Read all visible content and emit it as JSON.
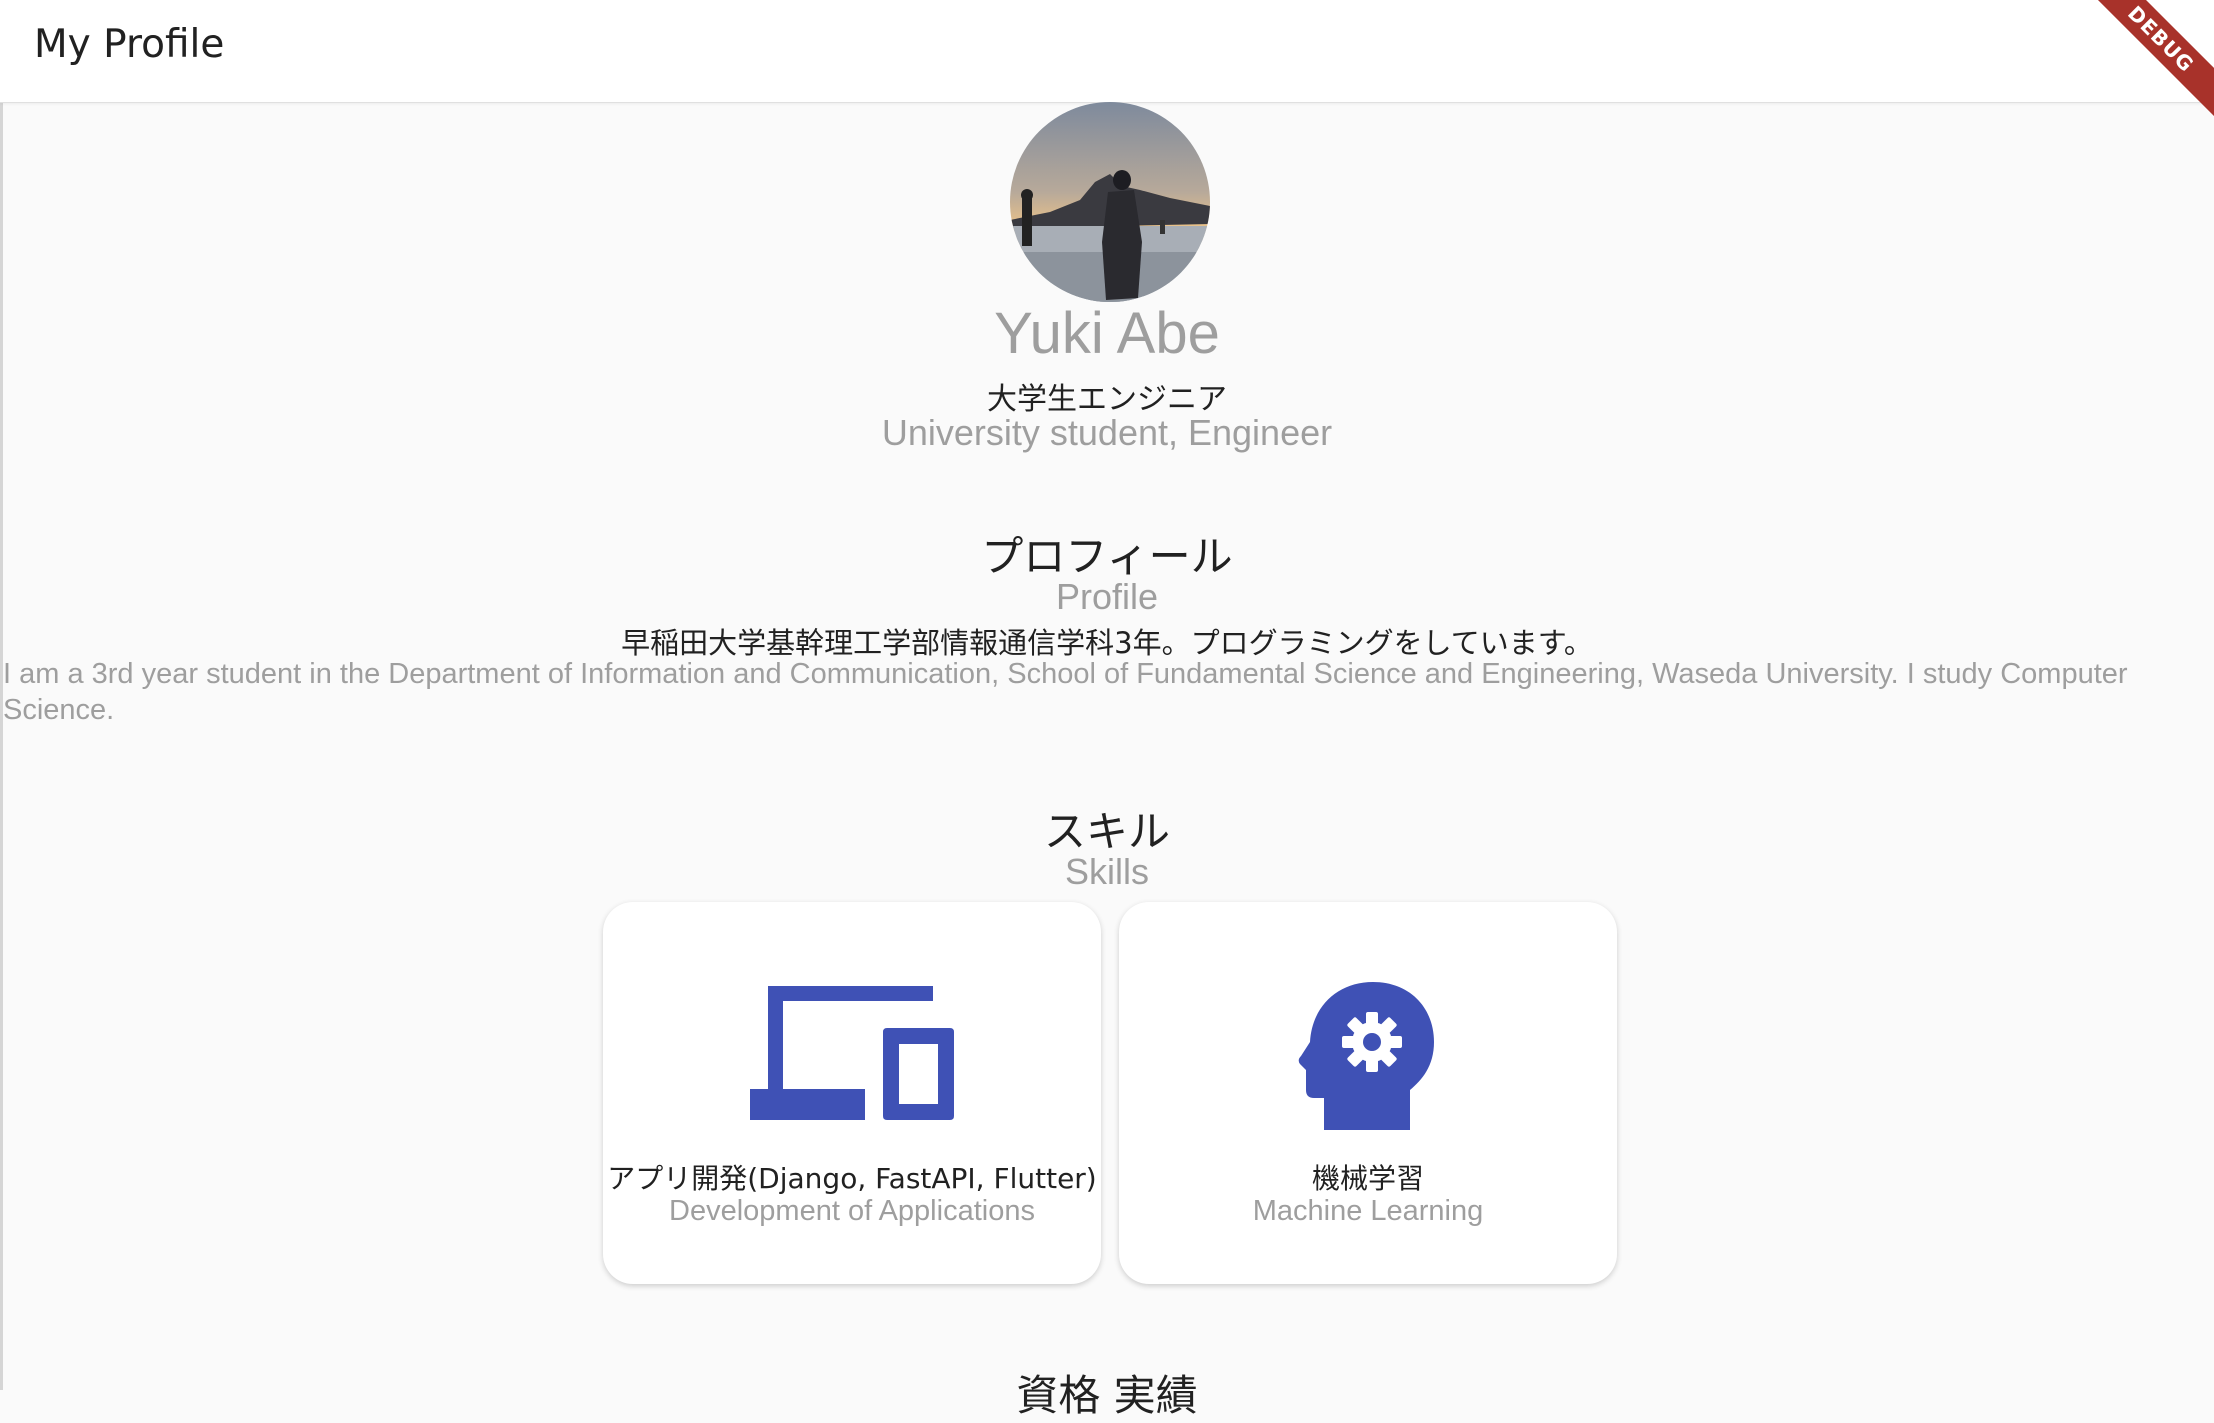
{
  "appbar": {
    "title": "My Profile",
    "debug_banner": "DEBUG"
  },
  "profile_header": {
    "name": "Yuki Abe",
    "subtitle_ja": "大学生エンジニア",
    "subtitle_en": "University student, Engineer"
  },
  "profile_section": {
    "title_ja": "プロフィール",
    "title_en": "Profile",
    "body_ja": "早稲田大学基幹理工学部情報通信学科3年。プログラミングをしています。",
    "body_en": "I am a 3rd year student in the Department of Information and Communication, School of Fundamental Science and Engineering, Waseda University. I study Computer Science."
  },
  "skills_section": {
    "title_ja": "スキル",
    "title_en": "Skills",
    "cards": [
      {
        "icon": "devices-icon",
        "label_ja": "アプリ開発(Django, FastAPI, Flutter)",
        "label_en": "Development of Applications"
      },
      {
        "icon": "psychology-gear-head-icon",
        "label_ja": "機械学習",
        "label_en": "Machine Learning"
      }
    ]
  },
  "next_section": {
    "title_ja": "資格 実績"
  },
  "colors": {
    "accent": "#3f51b5",
    "text_primary": "#212121",
    "text_secondary": "#9e9e9e",
    "background": "#fafafa",
    "debug": "#a8322a"
  }
}
